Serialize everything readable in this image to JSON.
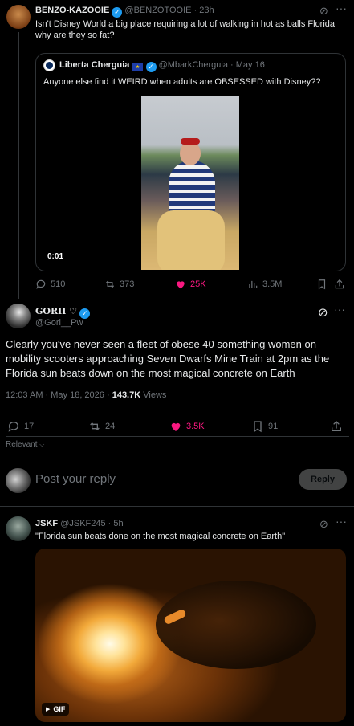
{
  "tweet1": {
    "name": "BENZO-KAZOOIE",
    "handle": "@BENZOTOOIE",
    "sep": "·",
    "time": "23h",
    "text": "Isn't Disney World a big place requiring a lot of walking in hot as balls Florida why are they so fat?",
    "quote": {
      "name": "Liberta Cherguia",
      "handle": "@MbarkCherguia",
      "time": "May 16",
      "text": "Anyone else find it WEIRD when adults are OBSESSED with Disney??",
      "video_time": "0:01"
    },
    "actions": {
      "replies": "510",
      "reposts": "373",
      "likes": "25K",
      "views": "3.5M"
    }
  },
  "tweet2": {
    "name": "GORII ♡",
    "handle": "@Gori__Pw",
    "text": "Clearly you've never seen a fleet of obese 40 something women on mobility scooters approaching Seven Dwarfs Mine Train at 2pm as the Florida sun beats down on the most magical concrete on Earth",
    "timestamp": "12:03 AM · May 18, 2026 ·",
    "views_count": "143.7K",
    "views_label": "Views",
    "actions": {
      "replies": "17",
      "reposts": "24",
      "likes": "3.5K",
      "bookmarks": "91"
    }
  },
  "sort": {
    "label": "Relevant"
  },
  "reply_box": {
    "placeholder": "Post your reply",
    "button": "Reply"
  },
  "tweet3": {
    "name": "JSKF",
    "handle": "@JSKF245",
    "sep": "·",
    "time": "5h",
    "text": "\"Florida sun beats done on the most magical concrete on Earth\"",
    "gif_label": "GIF"
  },
  "colors": {
    "like": "#f91880",
    "accent": "#1d9bf0",
    "muted": "#71767b"
  }
}
